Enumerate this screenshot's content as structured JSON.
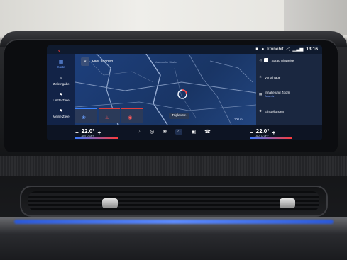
{
  "window": {
    "back_icon": "chevron-left-icon"
  },
  "status_bar": {
    "profile": "kronehit",
    "time": "13:16",
    "icons": [
      "trash-icon",
      "profile-icon",
      "volume-icon",
      "signal-icon"
    ]
  },
  "left_nav": [
    {
      "label": "Karte",
      "icon": "map-icon",
      "active": true
    },
    {
      "label": "Zieleingabe",
      "icon": "search-icon",
      "active": false
    },
    {
      "label": "Letzte Ziele",
      "icon": "history-icon",
      "active": false
    },
    {
      "label": "Meine Ziele",
      "icon": "star-icon",
      "active": false
    }
  ],
  "search": {
    "placeholder": "Hier suchen"
  },
  "map": {
    "street_label": "Vosendorfer Straße",
    "road_badge": "Triglavstr.",
    "scale": "100 m"
  },
  "quick_cards": [
    {
      "icon": "fan-icon",
      "accent": "#3b83ff"
    },
    {
      "icon": "seat-heat-icon",
      "accent": "#e23d3d"
    },
    {
      "icon": "steering-heat-icon",
      "accent": "#e23d3d"
    }
  ],
  "right_panel": [
    {
      "label": "Sprachhinweise",
      "sub": "",
      "icon": "speaker-icon",
      "checkbox": true
    },
    {
      "label": "Vorschläge",
      "sub": "",
      "icon": "bulb-icon",
      "checkbox": false
    },
    {
      "label": "Inhalte und Zoom",
      "sub": "Adaptiv",
      "icon": "layers-icon",
      "checkbox": false
    },
    {
      "label": "Einstellungen",
      "sub": "",
      "icon": "gear-icon",
      "checkbox": false
    }
  ],
  "climate": {
    "left": {
      "temp": "22.0°",
      "mode": "AUTO OFF",
      "minus": "−",
      "plus": "+"
    },
    "right": {
      "temp": "22.0°",
      "mode": "AUTO OFF",
      "minus": "−",
      "plus": "+"
    }
  },
  "dock": [
    {
      "icon": "music-icon"
    },
    {
      "icon": "compass-icon"
    },
    {
      "icon": "fan-icon"
    },
    {
      "icon": "home-icon"
    },
    {
      "icon": "apps-icon"
    },
    {
      "icon": "phone-icon"
    }
  ]
}
